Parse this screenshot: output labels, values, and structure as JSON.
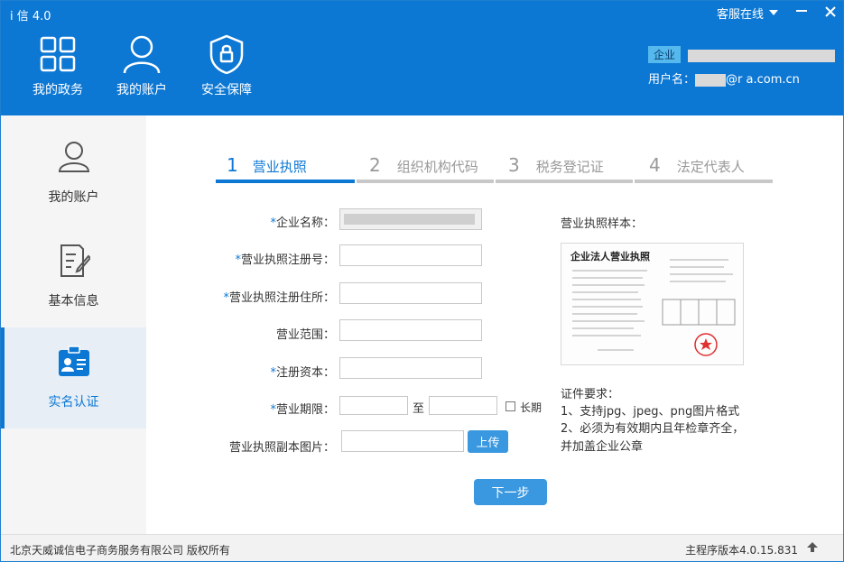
{
  "app": {
    "title": "i 信 4.0",
    "service_label": "客服在线"
  },
  "nav": [
    {
      "label": "我的政务",
      "icon": "grid-icon"
    },
    {
      "label": "我的账户",
      "icon": "user-icon"
    },
    {
      "label": "安全保障",
      "icon": "shield-icon"
    }
  ],
  "account": {
    "badge": "企业",
    "username_label": "用户名：",
    "username_value": "@r      a.com.cn"
  },
  "sidebar": [
    {
      "label": "我的账户",
      "icon": "user-outline-icon"
    },
    {
      "label": "基本信息",
      "icon": "document-edit-icon"
    },
    {
      "label": "实名认证",
      "icon": "id-badge-icon"
    }
  ],
  "steps": [
    {
      "num": "1",
      "label": "营业执照"
    },
    {
      "num": "2",
      "label": "组织机构代码"
    },
    {
      "num": "3",
      "label": "税务登记证"
    },
    {
      "num": "4",
      "label": "法定代表人"
    }
  ],
  "form": {
    "company_name_label": "企业名称：",
    "company_name_value": "...",
    "reg_no_label": "营业执照注册号：",
    "reg_addr_label": "营业执照注册住所：",
    "scope_label": "营业范围：",
    "capital_label": "注册资本：",
    "term_label": "营业期限：",
    "term_to": "至",
    "term_long": "长期",
    "copy_label": "营业执照副本图片：",
    "upload_label": "上传",
    "next_label": "下一步"
  },
  "sample": {
    "title": "营业执照样本：",
    "doc_title": "企业法人营业执照"
  },
  "requirements": {
    "heading": "证件要求：",
    "line1": "1、支持jpg、jpeg、png图片格式",
    "line2": "2、必须为有效期内且年检章齐全，",
    "line3": "并加盖企业公章"
  },
  "footer": {
    "copyright": "北京天威诚信电子商务服务有限公司 版权所有",
    "version": "主程序版本4.0.15.831"
  },
  "colors": {
    "brand": "#0d78d4",
    "button": "#3a98e0"
  }
}
